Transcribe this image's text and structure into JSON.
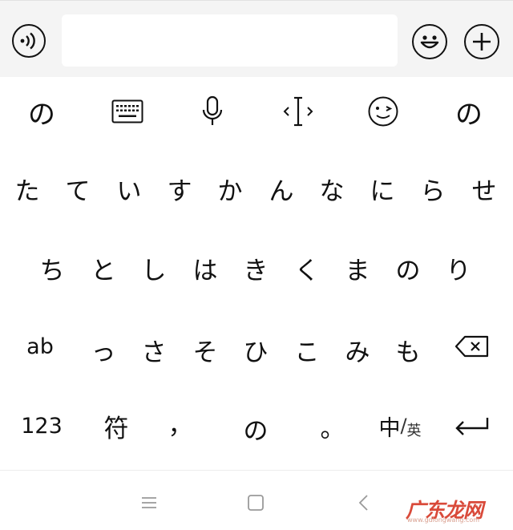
{
  "input_bar": {
    "voice_icon": "voice-wave-icon",
    "text_value": "",
    "emoji_icon": "smiley-icon",
    "plus_icon": "plus-icon"
  },
  "toolbar": {
    "left_kana": "の",
    "right_kana": "の",
    "keyboard_icon": "keyboard-icon",
    "mic_icon": "microphone-icon",
    "cursor_icon": "cursor-move-icon",
    "wink_icon": "wink-icon"
  },
  "rows": {
    "row1": [
      "た",
      "て",
      "い",
      "す",
      "か",
      "ん",
      "な",
      "に",
      "ら",
      "せ"
    ],
    "row2": [
      "ち",
      "と",
      "し",
      "は",
      "き",
      "く",
      "ま",
      "の",
      "り"
    ],
    "row3_left": "ab",
    "row3": [
      "っ",
      "さ",
      "そ",
      "ひ",
      "こ",
      "み",
      "も"
    ],
    "row4_num": "123",
    "row4_symbol": "符",
    "row4_comma": "，",
    "row4_kana": "の",
    "row4_period": "。",
    "row4_lang_main": "中",
    "row4_lang_sep": "/",
    "row4_lang_alt": "英"
  },
  "icons": {
    "backspace": "backspace-icon",
    "enter": "enter-icon"
  },
  "navbar": {
    "menu_icon": "menu-icon",
    "home_icon": "home-square-icon",
    "back_icon": "back-chevron-icon"
  },
  "watermark": {
    "text": "广东龙网",
    "sub": "www.gdlongwang.com"
  },
  "colors": {
    "input_bar_bg": "#f4f4f4",
    "key_text": "#111111",
    "nav_icon": "#9a9a9a",
    "watermark": "#d94a3a"
  }
}
